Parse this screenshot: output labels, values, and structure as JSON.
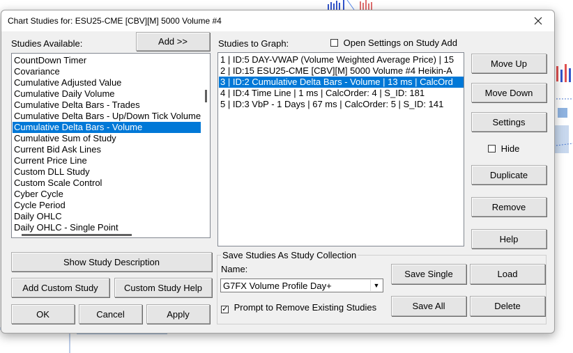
{
  "window": {
    "title": "Chart Studies for: ESU25-CME [CBV][M]  5000 Volume #4"
  },
  "available": {
    "label": "Studies Available:",
    "add_button": "Add >>",
    "items": [
      "CountDown Timer",
      "Covariance",
      "Cumulative Adjusted Value",
      "Cumulative Daily Volume",
      "Cumulative Delta Bars - Trades",
      "Cumulative Delta Bars - Up/Down Tick Volume",
      "Cumulative Delta Bars - Volume",
      "Cumulative Sum of Study",
      "Current Bid Ask Lines",
      "Current Price Line",
      "Custom DLL Study",
      "Custom Scale Control",
      "Cyber Cycle",
      "Cycle Period",
      "Daily OHLC",
      "Daily OHLC - Single Point"
    ],
    "selected_index": 6
  },
  "graph": {
    "label": "Studies to Graph:",
    "open_settings_label": "Open Settings on Study Add",
    "open_settings_checked": false,
    "items": [
      "1 | ID:5  DAY-VWAP (Volume Weighted Average Price) | 15",
      "2 | ID:15  ESU25-CME [CBV][M]  5000 Volume #4 Heikin-A",
      "3 | ID:2  Cumulative Delta Bars - Volume | 13 ms | CalcOrd",
      "4 | ID:4  Time Line | 1 ms | CalcOrder: 4 | S_ID: 181",
      "5 | ID:3  VbP - 1 Days | 67 ms | CalcOrder: 5 | S_ID: 141"
    ],
    "selected_index": 2
  },
  "side_buttons": {
    "move_up": "Move Up",
    "move_down": "Move Down",
    "settings": "Settings",
    "hide_label": "Hide",
    "hide_checked": false,
    "duplicate": "Duplicate",
    "remove": "Remove",
    "help": "Help"
  },
  "left_buttons": {
    "show_desc": "Show Study Description",
    "add_custom": "Add Custom Study",
    "custom_help": "Custom Study Help",
    "ok": "OK",
    "cancel": "Cancel",
    "apply": "Apply"
  },
  "collection": {
    "group_label": "Save Studies As Study Collection",
    "name_label": "Name:",
    "name_value": "G7FX Volume Profile Day+",
    "prompt_label": "Prompt to Remove Existing Studies",
    "prompt_checked": true,
    "save_single": "Save Single",
    "load": "Load",
    "save_all": "Save All",
    "delete": "Delete"
  },
  "colors": {
    "selection": "#0078d7",
    "dialog_bg": "#f0f0f0"
  }
}
